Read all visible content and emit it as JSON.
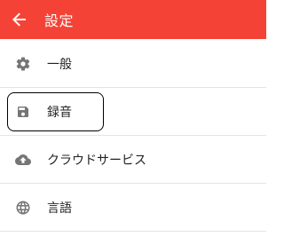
{
  "app_bar": {
    "title": "設定",
    "background_color": "#f44336",
    "back_icon": "arrow-left-icon"
  },
  "menu": {
    "items": [
      {
        "label": "一般",
        "icon": "gear-icon"
      },
      {
        "label": "録音",
        "icon": "floppy-disk-icon",
        "focused": true
      },
      {
        "label": "クラウドサービス",
        "icon": "cloud-upload-icon"
      },
      {
        "label": "言語",
        "icon": "globe-icon"
      }
    ]
  },
  "colors": {
    "icon": "#757575",
    "text": "#222222",
    "divider": "#e4e4e4",
    "focus_outline": "#000000"
  }
}
